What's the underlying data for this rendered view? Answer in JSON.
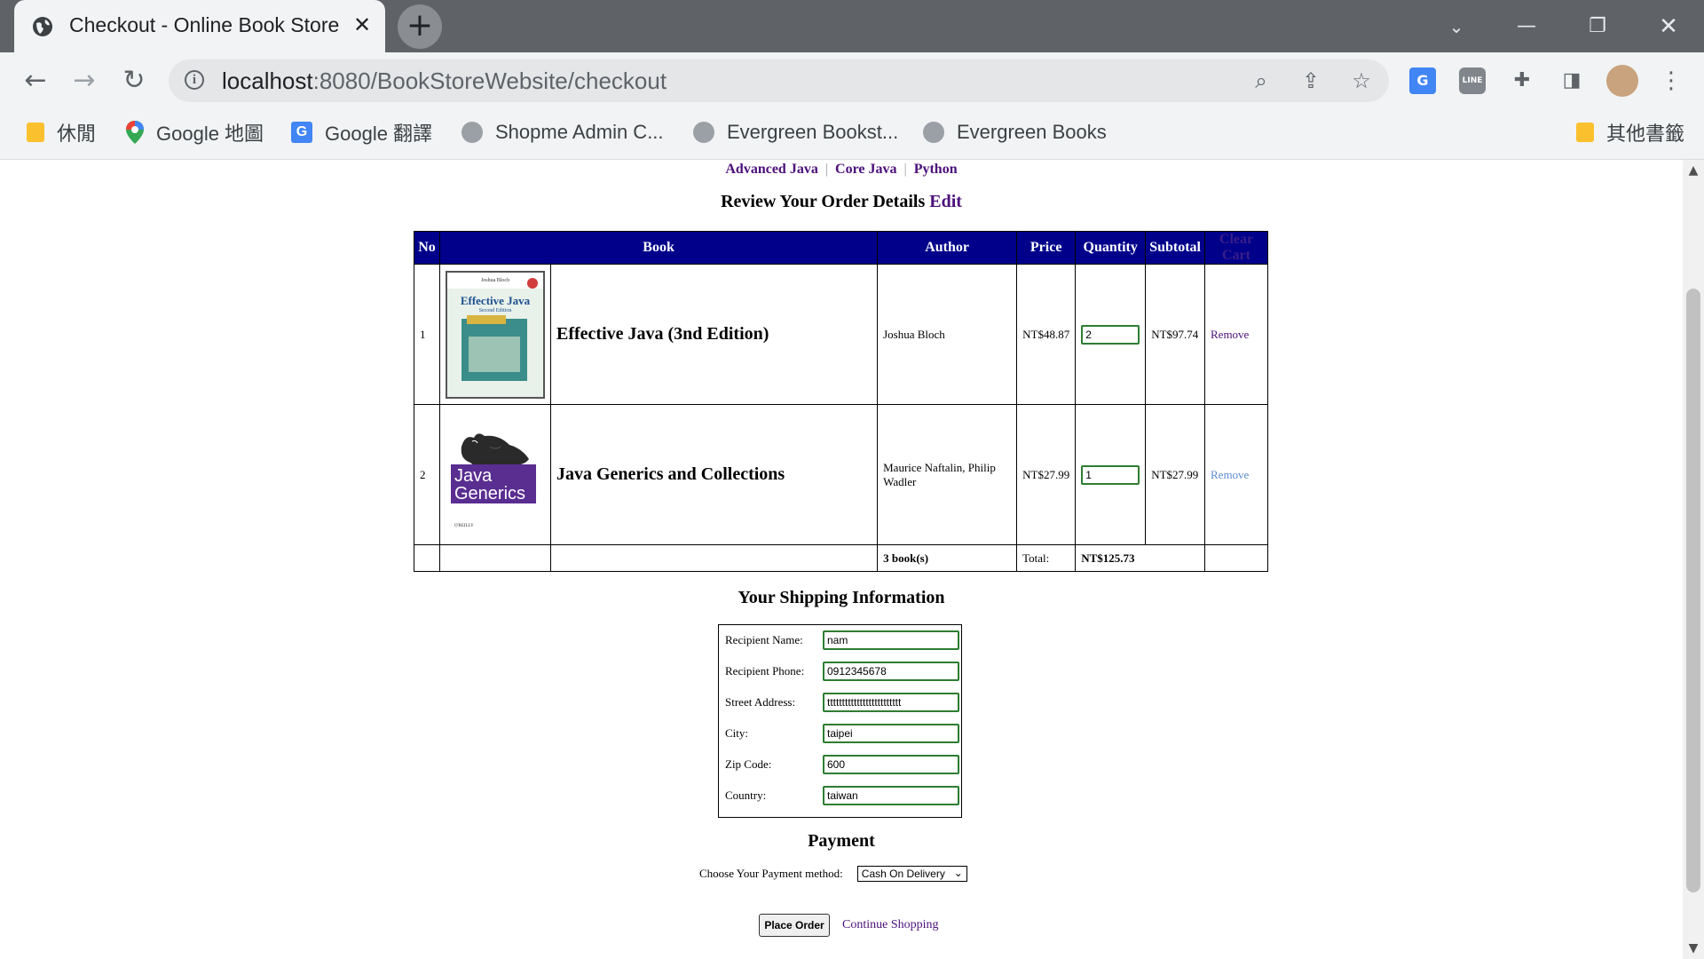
{
  "browser": {
    "tab_title": "Checkout - Online Book Store",
    "url_host": "localhost",
    "url_path": ":8080/BookStoreWebsite/checkout",
    "bookmarks": [
      {
        "label": "休閒",
        "icon": "folder-icon"
      },
      {
        "label": "Google 地圖",
        "icon": "maps-pin-icon"
      },
      {
        "label": "Google 翻譯",
        "icon": "translate-icon"
      },
      {
        "label": "Shopme Admin C...",
        "icon": "globe-icon"
      },
      {
        "label": "Evergreen Bookst...",
        "icon": "globe-icon"
      },
      {
        "label": "Evergreen Books",
        "icon": "globe-icon"
      }
    ],
    "other_bookmarks": "其他書籤"
  },
  "categories": [
    "Advanced Java",
    "Core Java",
    "Python"
  ],
  "review": {
    "title": "Review Your Order Details",
    "edit_label": "Edit"
  },
  "cart": {
    "headers": {
      "no": "No",
      "book": "Book",
      "author": "Author",
      "price": "Price",
      "quantity": "Quantity",
      "subtotal": "Subtotal",
      "clear": "Clear Cart"
    },
    "rows": [
      {
        "no": "1",
        "title": "Effective Java (3nd Edition)",
        "author": "Joshua Bloch",
        "price": "NT$48.87",
        "quantity": "2",
        "subtotal": "NT$97.74",
        "remove": "Remove"
      },
      {
        "no": "2",
        "title": "Java Generics and Collections",
        "author": "Maurice Naftalin, Philip Wadler",
        "price": "NT$27.99",
        "quantity": "1",
        "subtotal": "NT$27.99",
        "remove": "Remove"
      }
    ],
    "total_books": "3 book(s)",
    "total_label": "Total:",
    "total_value": "NT$125.73"
  },
  "covers": {
    "book1_header": "Joshua Bloch",
    "book1_title": "Effective Java",
    "book1_subtitle": "Second Edition",
    "book2_line1": "Java",
    "book2_line2": "Generics",
    "book2_footer": "O'REILLY"
  },
  "shipping": {
    "title": "Your Shipping Information",
    "fields": [
      {
        "label": "Recipient Name:",
        "value": "nam"
      },
      {
        "label": "Recipient Phone:",
        "value": "0912345678"
      },
      {
        "label": "Street Address:",
        "value": "ttttttttttttttttttttttttt"
      },
      {
        "label": "City:",
        "value": "taipei"
      },
      {
        "label": "Zip Code:",
        "value": "600"
      },
      {
        "label": "Country:",
        "value": "taiwan"
      }
    ]
  },
  "payment": {
    "title": "Payment",
    "label": "Choose Your Payment method:",
    "selected": "Cash On Delivery"
  },
  "actions": {
    "place_order": "Place Order",
    "continue_shopping": "Continue Shopping"
  },
  "colors": {
    "header_bg": "#00008b",
    "link": "#4b0f7a",
    "input_border": "#2e7d32"
  }
}
